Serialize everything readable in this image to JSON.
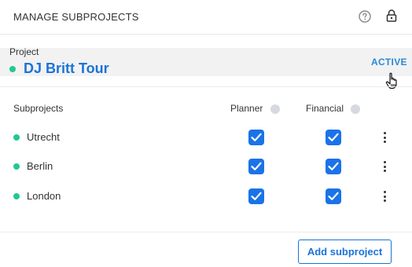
{
  "header": {
    "title": "MANAGE SUBPROJECTS",
    "help_icon": "help-circle-icon",
    "lock_icon": "lock-icon"
  },
  "project": {
    "label": "Project",
    "name": "DJ Britt Tour",
    "status_link": "ACTIVE",
    "status_color": "#22c98a"
  },
  "table": {
    "columns": {
      "subprojects": "Subprojects",
      "planner": "Planner",
      "financial": "Financial"
    },
    "rows": [
      {
        "name": "Utrecht",
        "planner": true,
        "financial": true
      },
      {
        "name": "Berlin",
        "planner": true,
        "financial": true
      },
      {
        "name": "London",
        "planner": true,
        "financial": true
      }
    ]
  },
  "footer": {
    "add_button": "Add subproject"
  },
  "colors": {
    "accent": "#1a73d9",
    "checkbox": "#1a73e8",
    "status_green": "#22c98a",
    "band_bg": "#f2f2f2"
  }
}
